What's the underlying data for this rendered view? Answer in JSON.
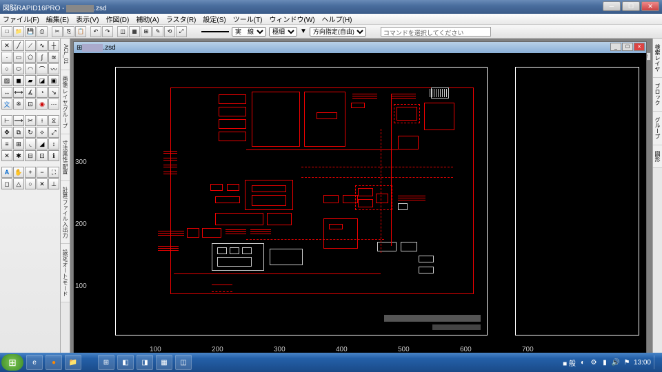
{
  "window": {
    "title": "図脳RAPID16PRO - ",
    "file_suffix": ".zsd"
  },
  "menu": {
    "file": "ファイル(F)",
    "edit": "編集(E)",
    "view": "表示(V)",
    "create": "作図(D)",
    "aux": "補助(A)",
    "raster": "ラスタ(R)",
    "settings": "設定(S)",
    "tools": "ツール(T)",
    "window": "ウィンドウ(W)",
    "help": "ヘルプ(H)"
  },
  "linebar": {
    "style": "実　線",
    "weight": "極細",
    "dir": "方向指定(自由)"
  },
  "cmdprompt": "コマンドを選択してください",
  "vtabs": {
    "t1": "ACL_01",
    "t2": "画像/レイヤ/グループ",
    "t3": "寸法属性/配置",
    "t4": "計算/ファイル入出力",
    "t5": "設定/オート/モード"
  },
  "rtabs": {
    "t1": "検索レイヤ",
    "t2": "ブロック",
    "t3": "グループ",
    "t4": "図形"
  },
  "doc": {
    "title_suffix": ".zsd"
  },
  "ruler_x": {
    "t100": "100",
    "t200": "200",
    "t300": "300",
    "t400": "400",
    "t500": "500",
    "t600": "600",
    "t700": "700"
  },
  "ruler_y": {
    "t100": "100",
    "t200": "200",
    "t300": "300"
  },
  "tray": {
    "ime": "■ 般",
    "time": "13:00"
  },
  "chart_data": {
    "type": "diagram",
    "description": "Electrical/piping schematic drawing on black CAD canvas",
    "primary_color": "#ee0000",
    "secondary_color": "#ffffff",
    "sheet_frames": 2,
    "approx_components": 60,
    "line_styles": [
      "solid",
      "dashed"
    ],
    "legend_region": "bottom-left",
    "title_block_region": "bottom-right"
  }
}
